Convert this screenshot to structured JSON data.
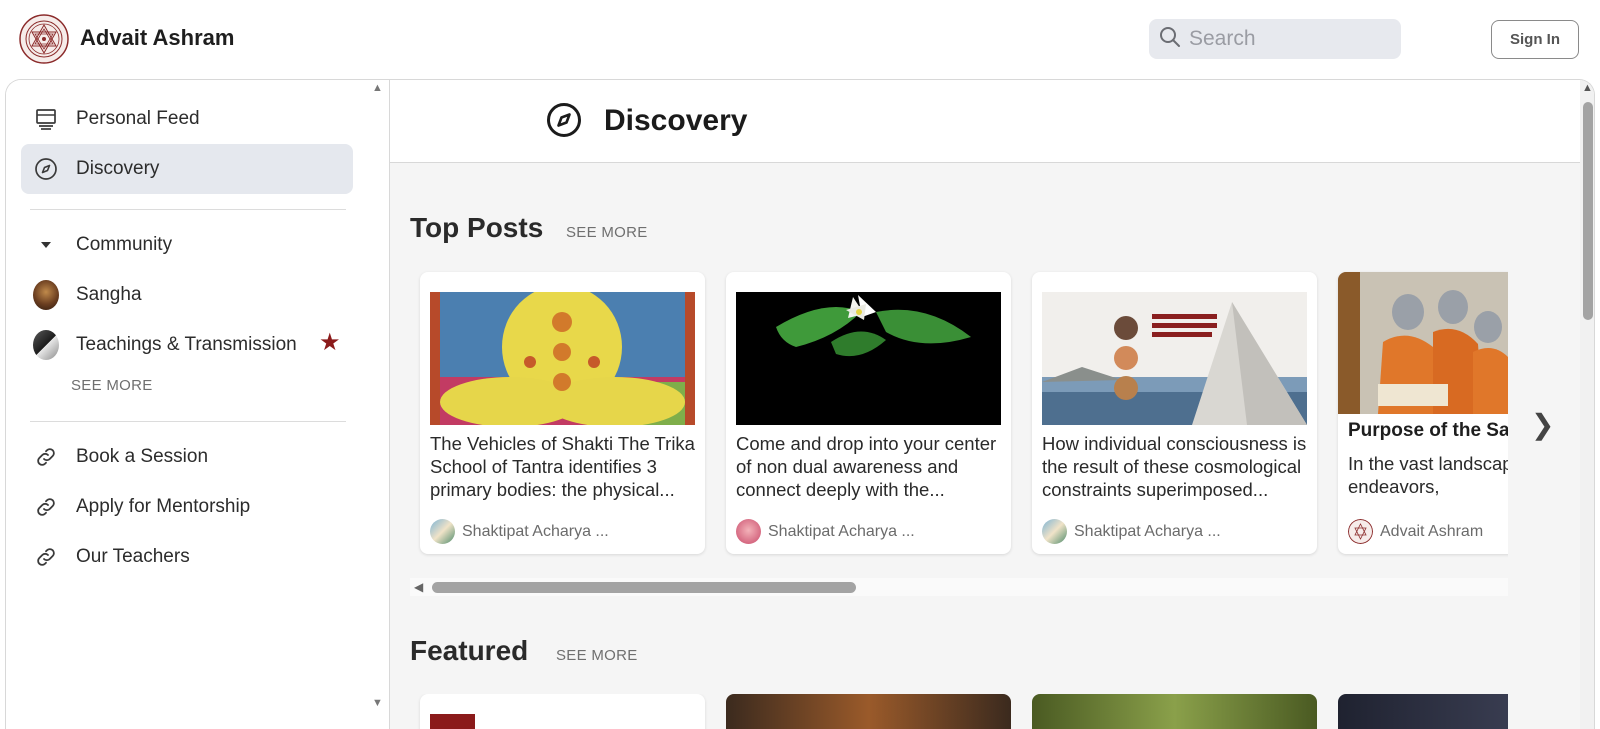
{
  "header": {
    "brand": "Advait Ashram",
    "search_placeholder": "Search",
    "signin_label": "Sign In",
    "logo_icon": "sri-yantra-logo"
  },
  "sidebar": {
    "items": [
      {
        "label": "Personal Feed",
        "icon": "monitor-icon"
      },
      {
        "label": "Discovery",
        "icon": "compass-icon",
        "active": true
      }
    ],
    "community_label": "Community",
    "community_items": [
      {
        "label": "Sangha",
        "icon": "avatar"
      },
      {
        "label": "Teachings & Transmission",
        "icon": "avatar",
        "starred": true
      }
    ],
    "see_more": "SEE MORE",
    "links": [
      {
        "label": "Book a Session",
        "icon": "link-icon"
      },
      {
        "label": "Apply for Mentorship",
        "icon": "link-icon"
      },
      {
        "label": "Our Teachers",
        "icon": "link-icon"
      }
    ]
  },
  "main": {
    "title": "Discovery",
    "top_posts": {
      "title": "Top Posts",
      "see_more": "SEE MORE",
      "cards": [
        {
          "text": "The Vehicles of Shakti The Trika School of Tantra identifies 3 primary bodies: the physical...",
          "author": "Shaktipat Acharya ..."
        },
        {
          "text": "Come and drop into your center of non dual awareness and connect deeply with the...",
          "author": "Shaktipat Acharya ..."
        },
        {
          "text": "How individual consciousness is the result of these cosmological constraints superimposed...",
          "author": "Shaktipat Acharya ..."
        },
        {
          "title": "Purpose of the Sar",
          "text": "In the vast landscap spiritual endeavors,",
          "author": "Advait Ashram"
        }
      ]
    },
    "featured": {
      "title": "Featured",
      "see_more": "SEE MORE"
    }
  },
  "colors": {
    "accent_star": "#8b1a1a",
    "active_bg": "#e5e8ee",
    "search_bg": "#e7e9ee",
    "main_bg": "#f5f5f5"
  }
}
